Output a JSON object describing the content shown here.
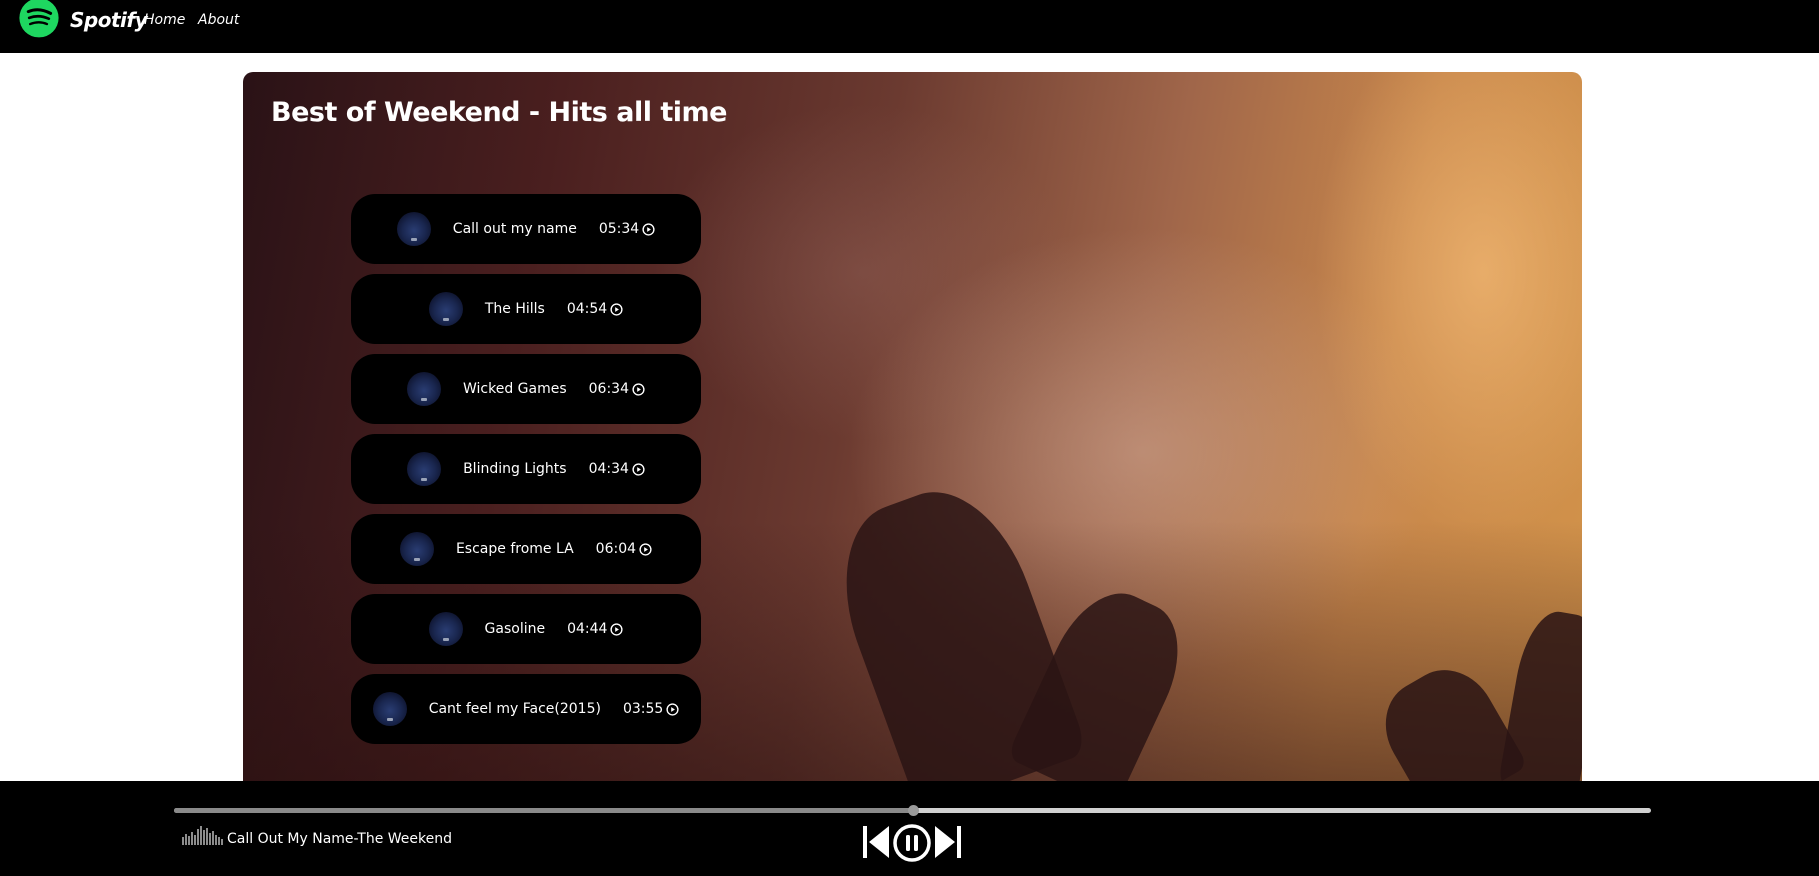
{
  "navbar": {
    "brand": "Spotify",
    "links": [
      {
        "label": "Home"
      },
      {
        "label": "About"
      }
    ],
    "logo_icon": "spotify-logo-icon",
    "accent_color": "#1ed760"
  },
  "hero": {
    "title": "Best of Weekend - Hits all time"
  },
  "songs": [
    {
      "name": "Call out my name",
      "duration": "05:34"
    },
    {
      "name": "The Hills",
      "duration": "04:54"
    },
    {
      "name": "Wicked Games",
      "duration": "06:34"
    },
    {
      "name": "Blinding Lights",
      "duration": "04:34"
    },
    {
      "name": "Escape frome LA",
      "duration": "06:04"
    },
    {
      "name": "Gasoline",
      "duration": "04:44"
    },
    {
      "name": "Cant feel my Face(2015)",
      "duration": "03:55"
    }
  ],
  "player": {
    "now_playing": "Call Out My Name-The Weekend",
    "progress": 0.5,
    "icons": {
      "previous": "skip-previous-icon",
      "pause": "pause-circle-icon",
      "next": "skip-next-icon",
      "wave": "audio-wave-icon"
    }
  }
}
